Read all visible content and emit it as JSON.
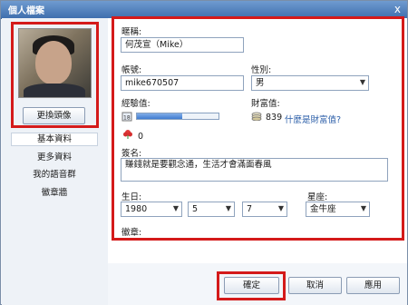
{
  "window": {
    "title": "個人檔案",
    "close_label": "x"
  },
  "left": {
    "change_avatar": "更換頭像",
    "nav": [
      {
        "label": "基本資料",
        "active": true
      },
      {
        "label": "更多資料",
        "active": false
      },
      {
        "label": "我的語音群",
        "active": false
      },
      {
        "label": "徽章牆",
        "active": false
      }
    ]
  },
  "form": {
    "nickname_label": "暱稱:",
    "nickname_value": "何茂宣（Mike）",
    "account_label": "帳號:",
    "account_value": "mike670507",
    "gender_label": "性別:",
    "gender_value": "男",
    "exp_label": "經驗值:",
    "exp_icon_text": "18",
    "exp_progress": 0.56,
    "wealth_label": "財富值:",
    "wealth_value": "839",
    "wealth_link": "什麼是財富值?",
    "flower_count": "0",
    "signature_label": "簽名:",
    "signature_value": "賺錢就是要觀念通，生活才會滿面春風",
    "birthday_label": "生日:",
    "birth_year": "1980",
    "birth_month": "5",
    "birth_day": "7",
    "zodiac_label": "星座:",
    "zodiac_value": "金牛座",
    "badge_label": "徽章:"
  },
  "footer": {
    "ok": "確定",
    "cancel": "取消",
    "apply": "應用"
  },
  "colors": {
    "highlight_red": "#d41a1a",
    "titlebar": "#4f7fbe",
    "link": "#2b5ea8"
  }
}
